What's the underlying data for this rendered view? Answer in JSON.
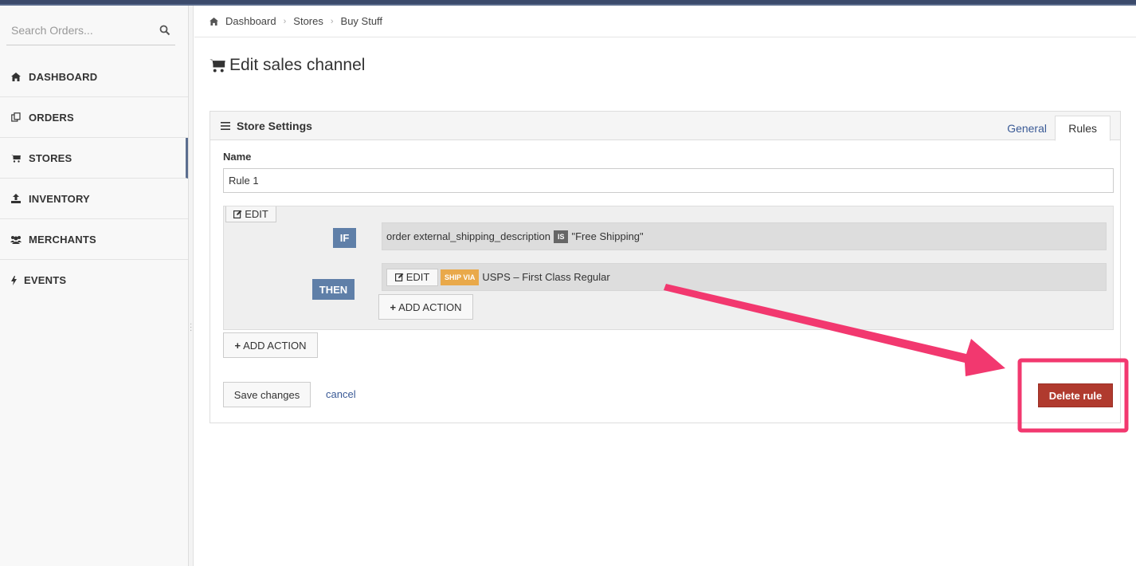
{
  "sidebar": {
    "search": {
      "placeholder": "Search Orders..."
    },
    "items": [
      {
        "label": "DASHBOARD",
        "icon": "home-icon"
      },
      {
        "label": "ORDERS",
        "icon": "orders-icon"
      },
      {
        "label": "STORES",
        "icon": "cart-icon"
      },
      {
        "label": "INVENTORY",
        "icon": "upload-icon"
      },
      {
        "label": "MERCHANTS",
        "icon": "users-icon"
      },
      {
        "label": "EVENTS",
        "icon": "bolt-icon"
      }
    ],
    "active_item": "STORES"
  },
  "breadcrumb": [
    "Dashboard",
    "Stores",
    "Buy Stuff"
  ],
  "page": {
    "title": "Edit sales channel"
  },
  "panel": {
    "title": "Store Settings",
    "tabs": [
      "General",
      "Rules"
    ],
    "active_tab": "Rules",
    "name_label": "Name",
    "name_value": "Rule 1",
    "edit_label": "EDIT",
    "if_label": "IF",
    "condition": {
      "field": "order external_shipping_description",
      "operator": "IS",
      "value": "\"Free Shipping\""
    },
    "then_label": "THEN",
    "action": {
      "edit_label": "EDIT",
      "badge": "SHIP VIA",
      "value": "USPS – First Class Regular"
    },
    "add_action_inner": "ADD ACTION",
    "add_action_outer": "ADD ACTION",
    "save_label": "Save changes",
    "cancel_label": "cancel",
    "delete_label": "Delete rule"
  },
  "colors": {
    "accent": "#5f7fa8",
    "delete": "#b03a2e",
    "ship_badge": "#e9a94a",
    "annotation": "#f2386f",
    "link": "#3a5a96"
  }
}
